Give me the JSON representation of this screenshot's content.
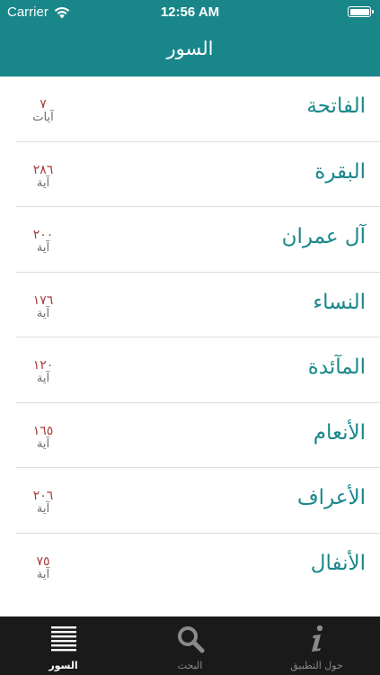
{
  "status_bar": {
    "carrier": "Carrier",
    "time": "12:56 AM"
  },
  "nav": {
    "title": "السور"
  },
  "suras": [
    {
      "name": "الفاتحة",
      "count": "٧",
      "unit": "آيات"
    },
    {
      "name": "البقرة",
      "count": "٢٨٦",
      "unit": "آية"
    },
    {
      "name": "آل عمران",
      "count": "٢٠٠",
      "unit": "آية"
    },
    {
      "name": "النساء",
      "count": "١٧٦",
      "unit": "آية"
    },
    {
      "name": "المآئدة",
      "count": "١٢٠",
      "unit": "آية"
    },
    {
      "name": "الأنعام",
      "count": "١٦٥",
      "unit": "آية"
    },
    {
      "name": "الأعراف",
      "count": "٢٠٦",
      "unit": "آية"
    },
    {
      "name": "الأنفال",
      "count": "٧٥",
      "unit": "آية"
    }
  ],
  "tabs": [
    {
      "label": "السور",
      "icon": "list-icon",
      "active": true
    },
    {
      "label": "البحث",
      "icon": "search-icon",
      "active": false
    },
    {
      "label": "حول التطبيق",
      "icon": "info-icon",
      "active": false
    }
  ],
  "colors": {
    "header": "#19878a",
    "sura_name": "#19878a",
    "ayah_number": "#a63a3a",
    "tabbar": "#1a1a1a"
  }
}
